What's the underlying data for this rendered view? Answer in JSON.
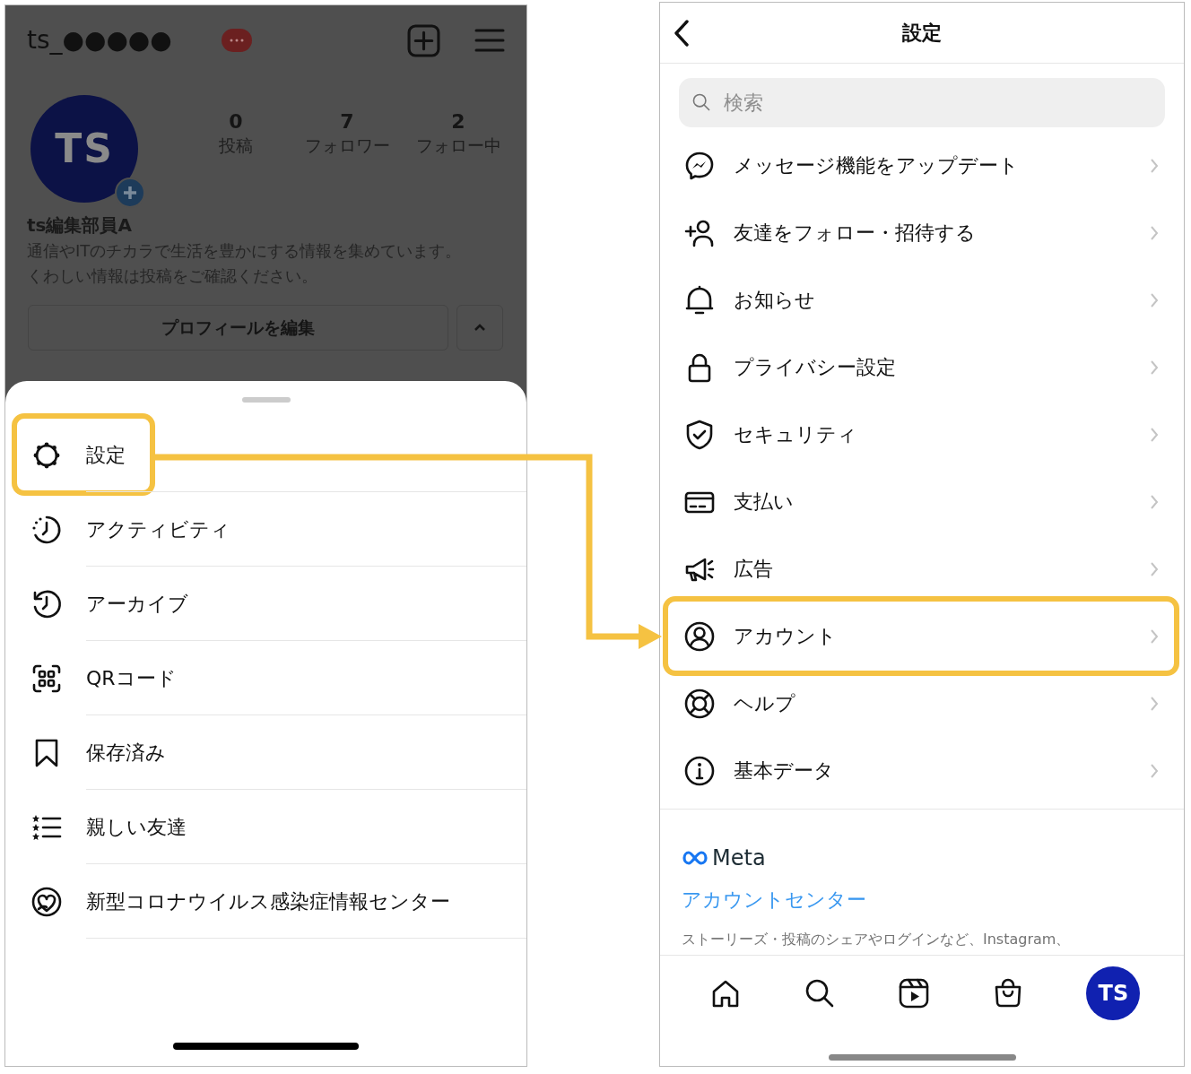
{
  "left_phone": {
    "username": "ts_●●●●●",
    "avatar_initials": "TS",
    "stats": [
      {
        "count": "0",
        "label": "投稿"
      },
      {
        "count": "7",
        "label": "フォロワー"
      },
      {
        "count": "2",
        "label": "フォロー中"
      }
    ],
    "display_name": "ts編集部員A",
    "bio": [
      "通信やITのチカラで生活を豊かにする情報を集めています。",
      "くわしい情報は投稿をご確認ください。"
    ],
    "edit_profile_button": "プロフィールを編集",
    "menu": [
      {
        "kind": "gear",
        "label": "設定",
        "highlighted": true
      },
      {
        "kind": "activity",
        "label": "アクティビティ",
        "highlighted": false
      },
      {
        "kind": "archive",
        "label": "アーカイブ",
        "highlighted": false
      },
      {
        "kind": "qr",
        "label": "QRコード",
        "highlighted": false
      },
      {
        "kind": "bookmark",
        "label": "保存済み",
        "highlighted": false
      },
      {
        "kind": "stars",
        "label": "親しい友達",
        "highlighted": false
      },
      {
        "kind": "heart",
        "label": "新型コロナウイルス感染症情報センター",
        "highlighted": false
      }
    ]
  },
  "right_phone": {
    "title": "設定",
    "search": {
      "placeholder": "検索"
    },
    "items": [
      {
        "kind": "messenger",
        "label": "メッセージ機能をアップデート",
        "highlighted": false
      },
      {
        "kind": "addperson",
        "label": "友達をフォロー・招待する",
        "highlighted": false
      },
      {
        "kind": "bell",
        "label": "お知らせ",
        "highlighted": false
      },
      {
        "kind": "lock",
        "label": "プライバシー設定",
        "highlighted": false
      },
      {
        "kind": "shield",
        "label": "セキュリティ",
        "highlighted": false
      },
      {
        "kind": "card",
        "label": "支払い",
        "highlighted": false
      },
      {
        "kind": "megaphone",
        "label": "広告",
        "highlighted": false
      },
      {
        "kind": "person",
        "label": "アカウント",
        "highlighted": true
      },
      {
        "kind": "lifebuoy",
        "label": "ヘルプ",
        "highlighted": false
      },
      {
        "kind": "info",
        "label": "基本データ",
        "highlighted": false
      }
    ],
    "meta_logo": "Meta",
    "accounts_center_link": "アカウントセンター",
    "description": "ストーリーズ・投稿のシェアやログインなど、Instagram、",
    "nav": [
      {
        "kind": "home"
      },
      {
        "kind": "search"
      },
      {
        "kind": "reels"
      },
      {
        "kind": "shop"
      },
      {
        "kind": "avatar",
        "initials": "TS"
      }
    ]
  }
}
